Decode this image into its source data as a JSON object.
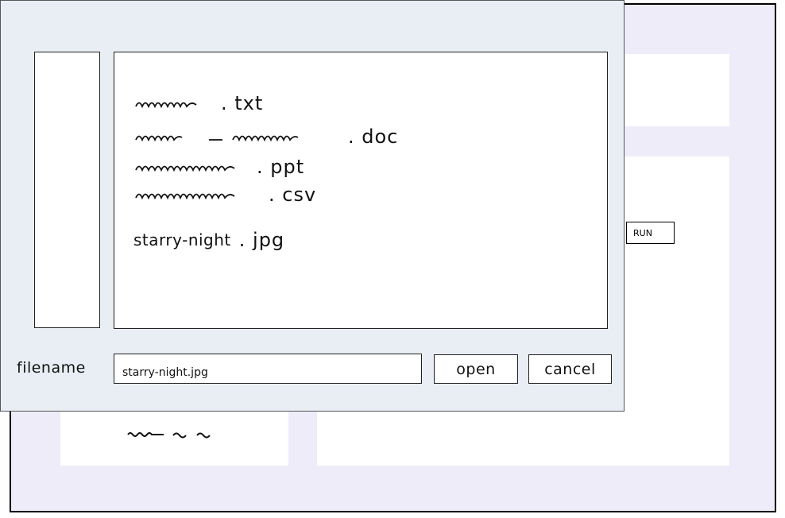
{
  "app": {
    "run_label": "RUN"
  },
  "dialog": {
    "files": [
      {
        "ext": ". txt"
      },
      {
        "ext": ". doc"
      },
      {
        "ext": ". ppt"
      },
      {
        "ext": ". csv"
      },
      {
        "name": "starry-night",
        "ext": ". jpg"
      }
    ],
    "filename_label": "filename",
    "filename_value": "starry-night.jpg",
    "open_label": "open",
    "cancel_label": "cancel"
  }
}
